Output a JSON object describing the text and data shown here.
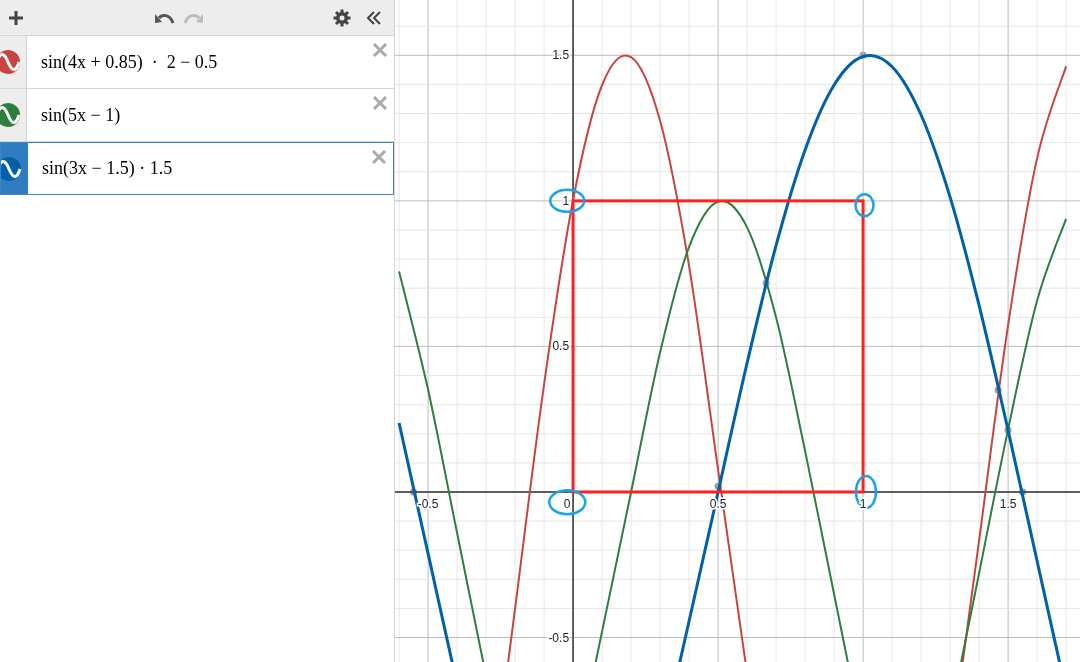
{
  "expressions": [
    {
      "text": "sin(4x + 0.85)  ·  2 − 0.5",
      "color": "#c74440",
      "selected": false
    },
    {
      "text": "sin(5x − 1)",
      "color": "#2d7f3e",
      "selected": false
    },
    {
      "text": "sin(3x − 1.5) · 1.5",
      "color": "#0060a8",
      "selected": true
    }
  ],
  "graph": {
    "chart_data": {
      "type": "line",
      "grid": true,
      "x": [
        -0.6,
        -0.5,
        -0.4,
        -0.3,
        -0.2,
        -0.1,
        0,
        0.1,
        0.2,
        0.3,
        0.4,
        0.5,
        0.6,
        0.7,
        0.8,
        0.9,
        1.0,
        1.1,
        1.2,
        1.3,
        1.4,
        1.5,
        1.6,
        1.7
      ],
      "series": [
        {
          "color": "#c74440",
          "values": [
            null,
            null,
            null,
            null,
            -0.4,
            0.37,
            1.003,
            1.398,
            1.494,
            1.275,
            0.776,
            0.076,
            null,
            null,
            null,
            null,
            null,
            null,
            null,
            null,
            -0.167,
            0.573,
            1.146,
            1.462
          ]
        },
        {
          "color": "#2d7f3e",
          "values": [
            0.757,
            0.351,
            -0.141,
            null,
            null,
            null,
            null,
            -0.479,
            0,
            0.479,
            0.842,
            0.998,
            0.909,
            0.599,
            0.141,
            -0.351,
            null,
            null,
            null,
            null,
            -0.279,
            0.215,
            0.657,
            0.938
          ]
        },
        {
          "color": "#0060a8",
          "values": [
            0.237,
            -0.212,
            null,
            null,
            null,
            null,
            null,
            null,
            null,
            null,
            -0.443,
            0,
            0.443,
            0.847,
            1.175,
            1.398,
            1.496,
            1.461,
            1.295,
            1.013,
            0.641,
            0.212,
            -0.237,
            null
          ]
        }
      ],
      "xlim": [
        -0.614,
        1.748
      ],
      "ylim": [
        -0.584,
        1.69
      ],
      "xticks": [
        -0.5,
        0,
        0.5,
        1,
        1.5
      ],
      "yticks": [
        -0.5,
        0.5,
        1,
        1.5
      ]
    }
  }
}
